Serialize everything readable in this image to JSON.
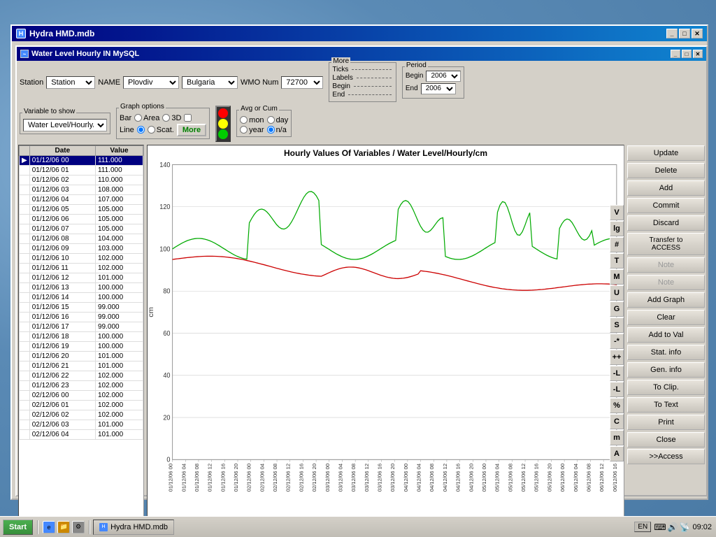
{
  "window": {
    "outer_title": "Hydra HMD.mdb",
    "inner_title": "Water Level Hourly IN MySQL"
  },
  "header": {
    "station_label": "Station",
    "name_label": "NAME",
    "station_value": "Plovdiv",
    "country_value": "Bulgaria",
    "wmo_label": "WMO Num",
    "wmo_value": "72700",
    "more_ticks_label": "More",
    "ticks_label": "Ticks",
    "labels_label": "Labels",
    "begin_label": "Begin",
    "end_label": "End",
    "period_label": "Period",
    "period_begin_label": "Begin",
    "period_end_label": "End",
    "period_begin_value": "2006",
    "period_end_value": "2006"
  },
  "variable_show": {
    "label": "Variable to show",
    "value": "Water Level/Hourly/c"
  },
  "graph_options": {
    "label": "Graph options",
    "bar_label": "Bar",
    "area_label": "Area",
    "three_d_label": "3D",
    "line_label": "Line",
    "scat_label": "Scat.",
    "more_label": "More"
  },
  "avg_cum": {
    "label": "Avg or Cum",
    "mon_label": "mon",
    "day_label": "day",
    "year_label": "year",
    "na_label": "n/a"
  },
  "chart": {
    "title": "Hourly Values Of Variables / Water Level/Hourly/cm",
    "y_label": "cm",
    "y_max": 140,
    "y_min": 0,
    "y_ticks": [
      0,
      20,
      40,
      60,
      80,
      100,
      120,
      140
    ]
  },
  "buttons": {
    "v": "V",
    "lg": "lg",
    "hash": "#",
    "t_upper": "T",
    "m_upper": "M",
    "u_upper": "U",
    "g_upper": "G",
    "s_upper": "S",
    "minus_star": "-*",
    "plus_plus": "++",
    "minus_l": "-L",
    "minus_l2": "-L",
    "percent": "%",
    "c_upper": "C",
    "m_lower": "m",
    "a_upper": "A",
    "update": "Update",
    "delete": "Delete",
    "add": "Add",
    "commit": "Commit",
    "discard": "Discard",
    "transfer_access": "Transfer to\nACCESS",
    "note1": "Note",
    "note2": "Note",
    "add_graph": "Add Graph",
    "clear": "Clear",
    "add_to_val": "Add to Val",
    "stat_info": "Stat. info",
    "gen_info": "Gen. info",
    "to_clip": "To Clip.",
    "to_text": "To Text",
    "print": "Print",
    "close": "Close",
    "access": ">>Access"
  },
  "table": {
    "headers": [
      "Date",
      "Value"
    ],
    "rows": [
      {
        "date": "01/12/06 00",
        "value": "111.000",
        "selected": true
      },
      {
        "date": "01/12/06 01",
        "value": "111.000"
      },
      {
        "date": "01/12/06 02",
        "value": "110.000"
      },
      {
        "date": "01/12/06 03",
        "value": "108.000"
      },
      {
        "date": "01/12/06 04",
        "value": "107.000"
      },
      {
        "date": "01/12/06 05",
        "value": "105.000"
      },
      {
        "date": "01/12/06 06",
        "value": "105.000"
      },
      {
        "date": "01/12/06 07",
        "value": "105.000"
      },
      {
        "date": "01/12/06 08",
        "value": "104.000"
      },
      {
        "date": "01/12/06 09",
        "value": "103.000"
      },
      {
        "date": "01/12/06 10",
        "value": "102.000"
      },
      {
        "date": "01/12/06 11",
        "value": "102.000"
      },
      {
        "date": "01/12/06 12",
        "value": "101.000"
      },
      {
        "date": "01/12/06 13",
        "value": "100.000"
      },
      {
        "date": "01/12/06 14",
        "value": "100.000"
      },
      {
        "date": "01/12/06 15",
        "value": "99.000"
      },
      {
        "date": "01/12/06 16",
        "value": "99.000"
      },
      {
        "date": "01/12/06 17",
        "value": "99.000"
      },
      {
        "date": "01/12/06 18",
        "value": "100.000"
      },
      {
        "date": "01/12/06 19",
        "value": "100.000"
      },
      {
        "date": "01/12/06 20",
        "value": "101.000"
      },
      {
        "date": "01/12/06 21",
        "value": "101.000"
      },
      {
        "date": "01/12/06 22",
        "value": "102.000"
      },
      {
        "date": "01/12/06 23",
        "value": "102.000"
      },
      {
        "date": "02/12/06 00",
        "value": "102.000"
      },
      {
        "date": "02/12/06 01",
        "value": "102.000"
      },
      {
        "date": "02/12/06 02",
        "value": "102.000"
      },
      {
        "date": "02/12/06 03",
        "value": "101.000"
      },
      {
        "date": "02/12/06 04",
        "value": "101.000"
      }
    ]
  },
  "taskbar": {
    "start": "Start",
    "app_label": "Hydra HMD.mdb",
    "lang": "EN",
    "time": "09:02"
  }
}
